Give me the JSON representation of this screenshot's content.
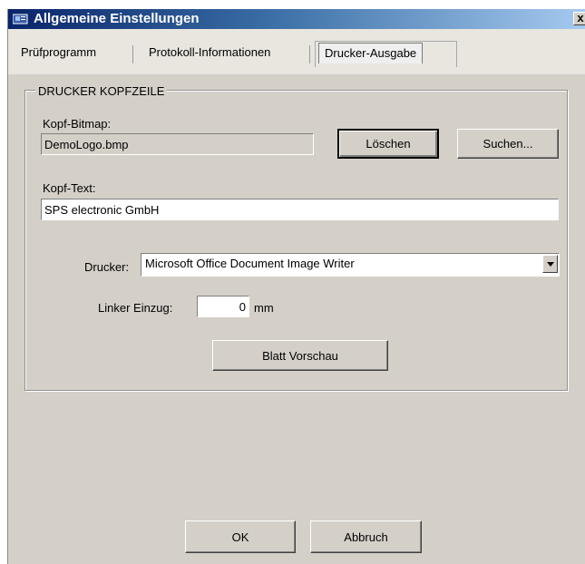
{
  "window": {
    "title": "Allgemeine Einstellungen",
    "close_label": "x"
  },
  "tabs": [
    {
      "label": "Prüfprogramm"
    },
    {
      "label": "Protokoll-Informationen"
    },
    {
      "label": "Drucker-Ausgabe",
      "active": true
    }
  ],
  "group": {
    "title": "DRUCKER KOPFZEILE",
    "bitmap_label": "Kopf-Bitmap:",
    "bitmap_value": "DemoLogo.bmp",
    "delete_label": "Löschen",
    "search_label": "Suchen...",
    "text_label": "Kopf-Text:",
    "text_value": "SPS electronic GmbH",
    "printer_label": "Drucker:",
    "printer_value": "Microsoft Office Document Image Writer",
    "indent_label": "Linker Einzug:",
    "indent_value": "0",
    "indent_unit": "mm",
    "preview_label": "Blatt Vorschau"
  },
  "footer": {
    "ok_label": "OK",
    "cancel_label": "Abbruch"
  }
}
